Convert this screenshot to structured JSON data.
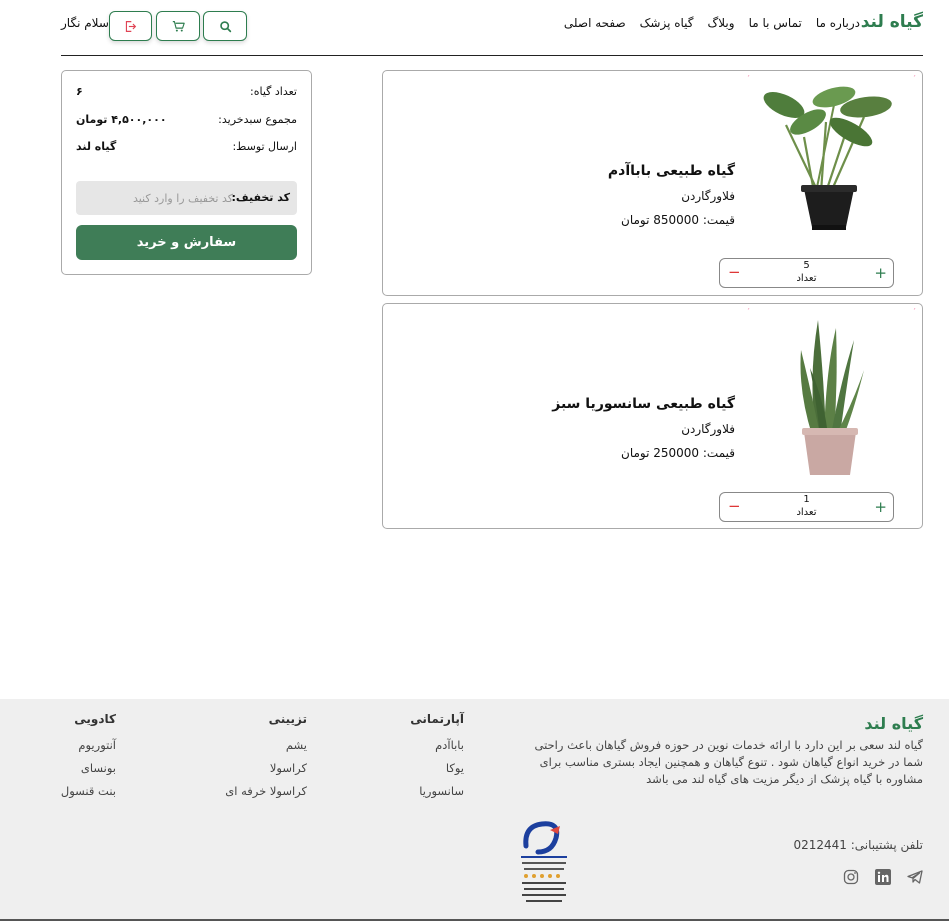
{
  "header": {
    "brand": "گیاه لند",
    "nav": [
      "صفحه اصلی",
      "گیاه پزشک",
      "وبلاگ",
      "تماس با ما",
      "درباره ما"
    ],
    "greeting": "سلام نگار",
    "icons": [
      "search-icon",
      "cart-icon",
      "logout-icon"
    ]
  },
  "cart": {
    "items": [
      {
        "name": "گیاه طبیعی باباآدم",
        "brand": "فلاورگاردن",
        "price": "قیمت: 850000 تومان",
        "quantity": "5",
        "quantity_label": "تعداد",
        "plus": "+",
        "minus": "−"
      },
      {
        "name": "گیاه طبیعی سانسوریا سبز",
        "brand": "فلاورگاردن",
        "price": "قیمت: 250000 تومان",
        "quantity": "1",
        "quantity_label": "تعداد",
        "plus": "+",
        "minus": "−"
      }
    ]
  },
  "summary": {
    "count_label": "تعداد گیاه:",
    "count_value": "۶",
    "total_label": "مجموع سبدخرید:",
    "total_value": "۴,۵۰۰,۰۰۰ تومان",
    "sender_label": "ارسال توسط:",
    "sender_value": "گیاه لند",
    "discount_label": "کد تخفیف:",
    "discount_placeholder": "کد تخفیف را وارد کنید",
    "order_button": "سفارش و خرید"
  },
  "footer": {
    "brand": "گیاه لند",
    "about": "گیاه لند سعی بر این دارد با ارائه خدمات نوین در حوزه فروش گیاهان باعث راحتی شما در خرید انواع گیاهان شود . تنوع گیاهان و همچنین ایجاد بستری مناسب برای مشاوره با گیاه پزشک از دیگر مزیت های گیاه لند می باشد",
    "columns": [
      {
        "title": "آپارتمانی",
        "links": [
          "باباآدم",
          "یوکا",
          "سانسوریا"
        ]
      },
      {
        "title": "تزیینی",
        "links": [
          "یشم",
          "کراسولا",
          "کراسولا خرفه ای"
        ]
      },
      {
        "title": "کادویی",
        "links": [
          "آنتوریوم",
          "بونسای",
          "بنت قنسول"
        ]
      }
    ],
    "phone": "تلفن پشتیبانی: 0212441",
    "socials": [
      "telegram-icon",
      "linkedin-icon",
      "instagram-icon"
    ]
  },
  "colors": {
    "brand": "#2e7d4f",
    "button": "#3f7d57",
    "minus": "#dd3333"
  }
}
